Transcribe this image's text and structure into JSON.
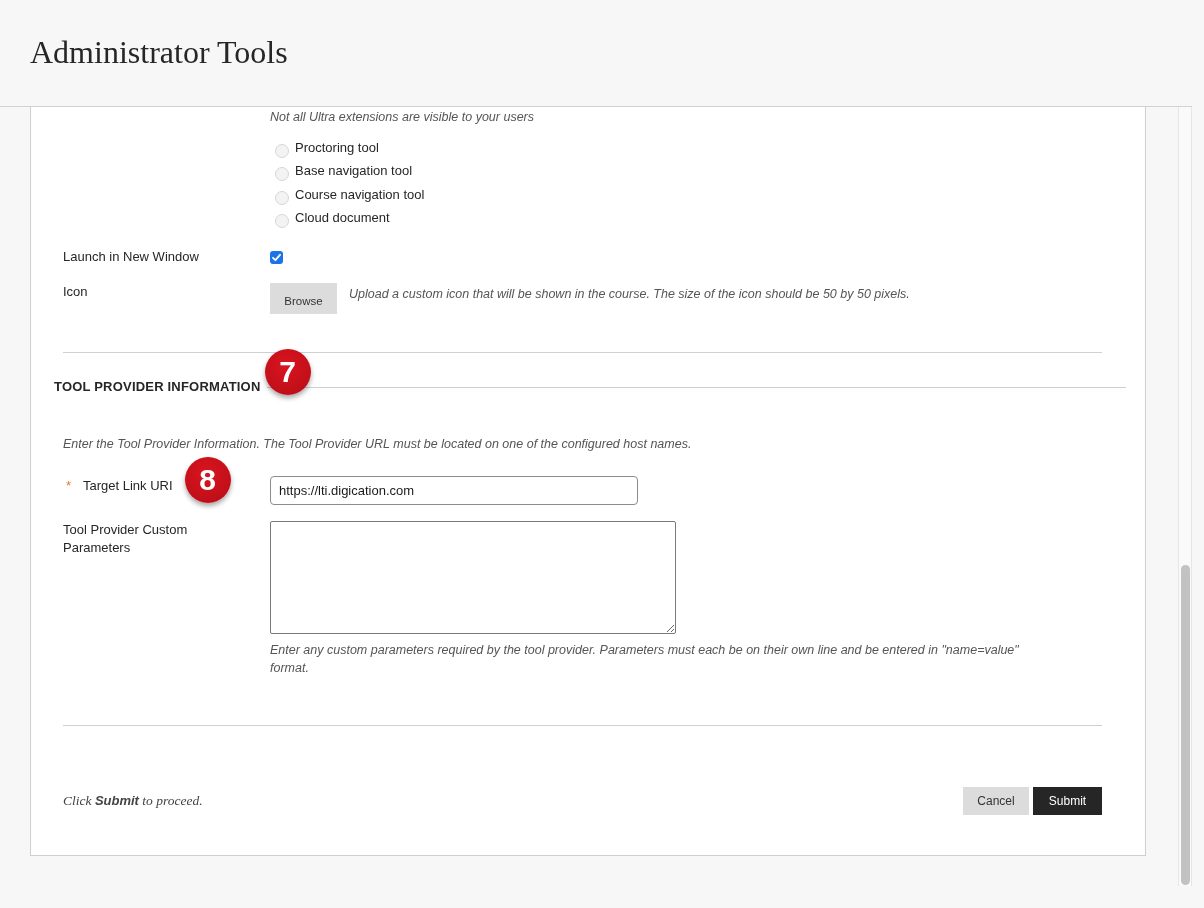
{
  "header": {
    "title": "Administrator Tools"
  },
  "extension_settings": {
    "note": "Not all Ultra extensions are visible to your users",
    "placement_options": [
      {
        "label": "Proctoring tool",
        "selected": false
      },
      {
        "label": "Base navigation tool",
        "selected": false
      },
      {
        "label": "Course navigation tool",
        "selected": false
      },
      {
        "label": "Cloud document",
        "selected": false
      }
    ],
    "launch_in_new_window": {
      "label": "Launch in New Window",
      "checked": true
    },
    "icon": {
      "label": "Icon",
      "button": "Browse",
      "hint": "Upload a custom icon that will be shown in the course. The size of the icon should be 50 by 50 pixels."
    }
  },
  "tool_provider_information": {
    "heading": "TOOL PROVIDER INFORMATION",
    "callout": "7",
    "instructions": "Enter the Tool Provider Information. The Tool Provider URL must be located on one of the configured host names.",
    "fields": [
      {
        "kind": "text",
        "label": "Target Link URI",
        "required_mark": "*",
        "value": "https://lti.digication.com",
        "callout": "8"
      },
      {
        "kind": "textarea",
        "label": "Tool Provider Custom Parameters",
        "hint": "Enter any custom parameters required by the tool provider. Parameters must each be on their own line and be entered in \"name=value\" format."
      }
    ]
  },
  "footer": {
    "prompt": "Click **Submit** to proceed.",
    "buttons": [
      {
        "label": "Cancel",
        "kind": "secondary"
      },
      {
        "label": "Submit",
        "kind": "primary"
      }
    ]
  }
}
